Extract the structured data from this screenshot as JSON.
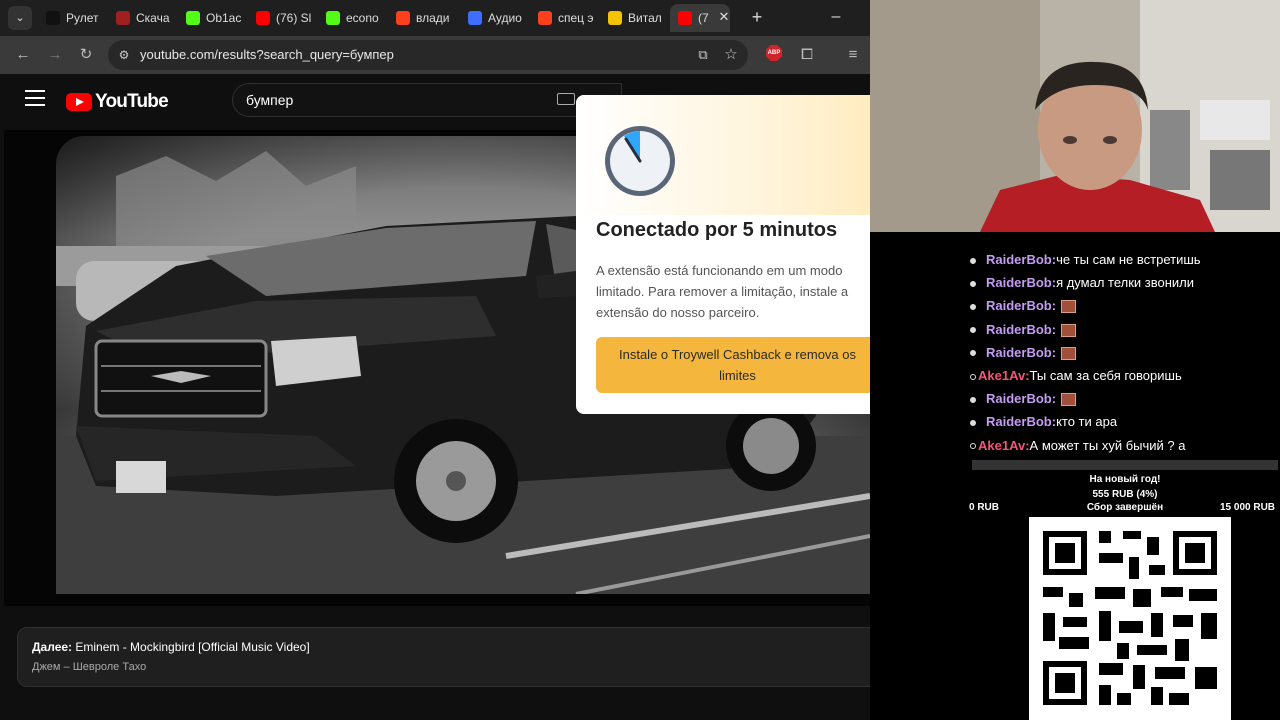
{
  "browser": {
    "tabs": [
      {
        "label": "Рулет",
        "icon": "tiktok-icon",
        "color": "#111111"
      },
      {
        "label": "Скача",
        "icon": "download-site-icon",
        "color": "#a02020"
      },
      {
        "label": "Ob1ac",
        "icon": "kick-icon",
        "color": "#53fc18"
      },
      {
        "label": "(76) Sl",
        "icon": "youtube-icon",
        "color": "#ff0000"
      },
      {
        "label": "econo",
        "icon": "kick-icon",
        "color": "#53fc18"
      },
      {
        "label": "влади",
        "icon": "yandex-icon",
        "color": "#fc3f1d"
      },
      {
        "label": "Аудио",
        "icon": "twitch-icon",
        "color": "#3d6eff"
      },
      {
        "label": "спец э",
        "icon": "yandex-icon",
        "color": "#fc3f1d"
      },
      {
        "label": "Витал",
        "icon": "play-icon",
        "color": "#f5c400"
      },
      {
        "label": "(7",
        "icon": "youtube-icon",
        "color": "#ff0000"
      }
    ],
    "url": "youtube.com/results?search_query=бумпер"
  },
  "youtube": {
    "logo_text": "YouTube",
    "search_value": "бумпер",
    "up_next_prefix": "Далее:",
    "up_next_title": "Eminem - Mockingbird [Official Music Video]",
    "up_next_subtitle": "Джем – Шевроле Тахо"
  },
  "popup": {
    "title": "Conectado por 5 minutos",
    "body": "A extensão está funcionando em um modo limitado. Para remover a limitação, instale a extensão do nosso parceiro.",
    "button": "Instale o Troywell Cashback e remova os limites",
    "accent": "#f4b63c"
  },
  "chat": {
    "messages": [
      {
        "nick": "RaiderBob:",
        "text": "че ты сам не встретишь",
        "style": "bob",
        "dot": "filled"
      },
      {
        "nick": "RaiderBob:",
        "text": "я думал телки звонили",
        "style": "bob",
        "dot": "filled"
      },
      {
        "nick": "RaiderBob:",
        "text": "",
        "style": "bob",
        "dot": "filled",
        "emote": true
      },
      {
        "nick": "RaiderBob:",
        "text": "",
        "style": "bob",
        "dot": "filled",
        "emote": true
      },
      {
        "nick": "RaiderBob:",
        "text": "",
        "style": "bob",
        "dot": "filled",
        "emote": true
      },
      {
        "nick": "Ake1Av:",
        "text": "Ты сам за себя говоришь",
        "style": "ake",
        "dot": "hollow"
      },
      {
        "nick": "RaiderBob:",
        "text": "",
        "style": "bob",
        "dot": "filled",
        "emote": true
      },
      {
        "nick": "RaiderBob:",
        "text": "кто ти ара",
        "style": "bob",
        "dot": "filled"
      },
      {
        "nick": "Ake1Av:",
        "text": "А может ты хуй бычий ? а",
        "style": "ake",
        "dot": "hollow"
      }
    ]
  },
  "goal": {
    "title": "На новый год!",
    "amount": "555 RUB (4%)",
    "min": "0 RUB",
    "status": "Сбор завершён",
    "max": "15 000 RUB",
    "progress_fraction": 0.037
  }
}
